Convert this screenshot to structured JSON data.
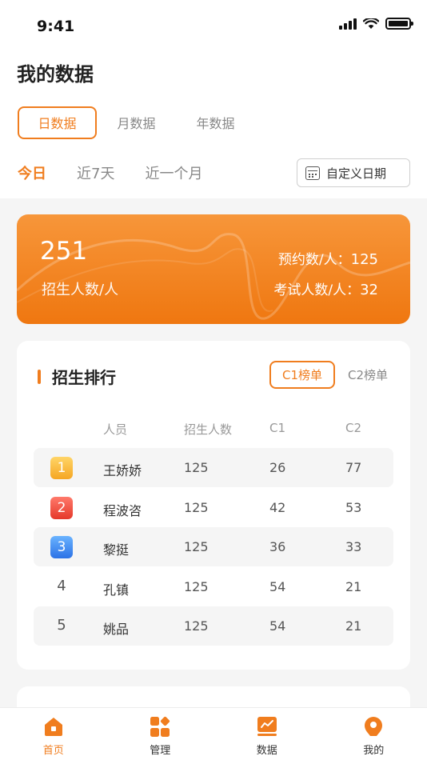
{
  "status": {
    "time": "9:41"
  },
  "page": {
    "title": "我的数据"
  },
  "period_tabs": [
    {
      "label": "日数据",
      "active": true
    },
    {
      "label": "月数据",
      "active": false
    },
    {
      "label": "年数据",
      "active": false
    }
  ],
  "range_tabs": [
    {
      "label": "今日",
      "active": true
    },
    {
      "label": "近7天",
      "active": false
    },
    {
      "label": "近一个月",
      "active": false
    }
  ],
  "custom_date": {
    "label": "自定义日期",
    "icon": "calendar-icon"
  },
  "stats": {
    "enroll_count": "251",
    "enroll_label": "招生人数/人",
    "reserve_label": "预约数/人：",
    "reserve_value": "125",
    "exam_label": "考试人数/人：",
    "exam_value": "32"
  },
  "ranking": {
    "title": "招生排行",
    "tabs": [
      {
        "label": "C1榜单",
        "active": true
      },
      {
        "label": "C2榜单",
        "active": false
      }
    ],
    "headers": {
      "rank": "",
      "name": "人员",
      "count": "招生人数",
      "c1": "C1",
      "c2": "C2"
    },
    "rows": [
      {
        "rank": "1",
        "name": "王娇娇",
        "count": "125",
        "c1": "26",
        "c2": "77"
      },
      {
        "rank": "2",
        "name": "程波咨",
        "count": "125",
        "c1": "42",
        "c2": "53"
      },
      {
        "rank": "3",
        "name": "黎挺",
        "count": "125",
        "c1": "36",
        "c2": "33"
      },
      {
        "rank": "4",
        "name": "孔镇",
        "count": "125",
        "c1": "54",
        "c2": "21"
      },
      {
        "rank": "5",
        "name": "姚品",
        "count": "125",
        "c1": "54",
        "c2": "21"
      }
    ]
  },
  "tabbar": [
    {
      "label": "首页",
      "icon": "home-icon",
      "active": true
    },
    {
      "label": "管理",
      "icon": "grid-icon",
      "active": false
    },
    {
      "label": "数据",
      "icon": "chart-icon",
      "active": false
    },
    {
      "label": "我的",
      "icon": "profile-icon",
      "active": false
    }
  ],
  "colors": {
    "accent": "#f07d1e"
  }
}
